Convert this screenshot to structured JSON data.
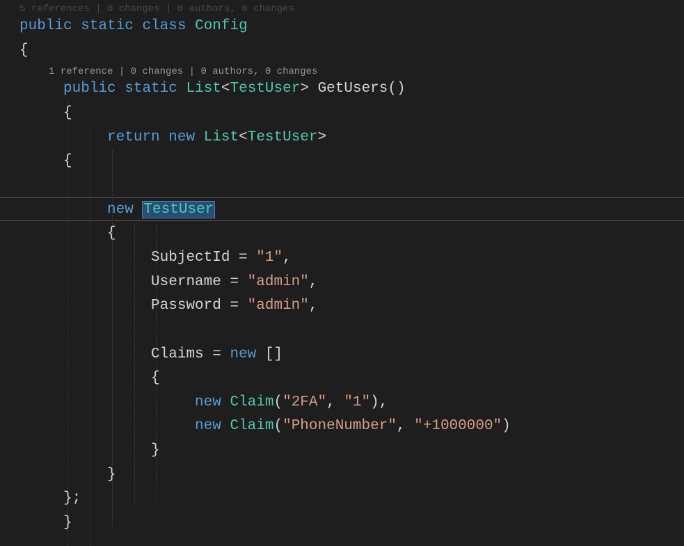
{
  "codelens": {
    "class_partial": "5 references | 0 changes | 0 authors, 0 changes",
    "method": "1 reference | 0 changes | 0 authors, 0 changes"
  },
  "tokens": {
    "public": "public",
    "static": "static",
    "class": "class",
    "config": "Config",
    "list": "List",
    "testuser": "TestUser",
    "getusers": "GetUsers",
    "return": "return",
    "new": "new",
    "subjectid": "SubjectId",
    "username": "Username",
    "password": "Password",
    "claims": "Claims",
    "claim": "Claim",
    "str_1": "\"1\"",
    "str_admin": "\"admin\"",
    "str_2fa": "\"2FA\"",
    "str_phone": "\"PhoneNumber\"",
    "str_num": "\"+1000000\""
  },
  "punct": {
    "lt": "<",
    "gt": ">",
    "lparen": "(",
    "rparen": ")",
    "lbrace": "{",
    "rbrace": "}",
    "lbracket": "[",
    "rbracket": "]",
    "comma": ",",
    "semicolon": ";",
    "eq": " = "
  }
}
